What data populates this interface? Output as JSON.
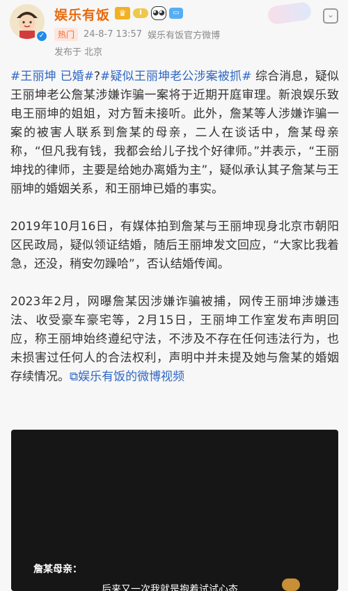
{
  "header": {
    "username": "娱乐有饭",
    "level_badge": "I",
    "hot_tag": "热门",
    "date": "24-8-7 13:57",
    "source": "娱乐有饭官方微博",
    "location": "发布于 北京"
  },
  "post": {
    "para1": {
      "tag1": "#王丽坤 已婚#",
      "q": "?",
      "tag2": "#疑似王丽坤老公涉案被抓#",
      "text": " 综合消息，疑似王丽坤老公詹某涉嫌诈骗一案将于近期开庭审理。新浪娱乐致电王丽坤的姐姐，对方暂未接听。此外，詹某等人涉嫌诈骗一案的被害人联系到詹某的母亲，二人在谈话中，詹某母亲称，“但凡我有钱，我都会给儿子找个好律师。”并表示，“王丽坤找的律师，主要是给她办离婚为主”，疑似承认其子詹某与王丽坤的婚姻关系，和王丽坤已婚的事实。"
    },
    "para2": "2019年10月16日，有媒体拍到詹某与王丽坤现身北京市朝阳区民政局，疑似领证结婚，随后王丽坤发文回应，“大家比我着急，还没，稍安勿躁哈”，否认结婚传闻。",
    "para3": "2023年2月，网曝詹某因涉嫌诈骗被捕，网传王丽坤涉嫌违法、收受豪车豪宅等，2月15日，王丽坤工作室发布声明回应，称王丽坤始终遵纪守法，不涉及不存在任何违法行为，也未损害过任何人的合法权利，声明中并未提及她与詹某的婚姻存续情况。",
    "video_link": "娱乐有饭的微博视频"
  },
  "video": {
    "speaker": "詹某母亲：",
    "subtitle": "后来又一次我就是抱着试试心态"
  },
  "colors": {
    "link": "#2f67c4",
    "username": "#e86b10",
    "hot": "#ef6a3e"
  }
}
